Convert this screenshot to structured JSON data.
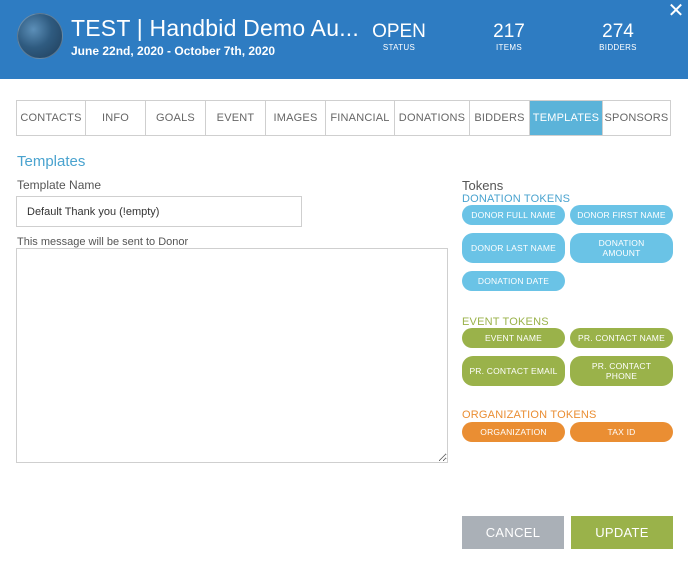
{
  "header": {
    "title": "TEST | Handbid Demo Au...",
    "dates": "June 22nd, 2020 - October 7th, 2020",
    "status": {
      "value": "OPEN",
      "label": "STATUS"
    },
    "items": {
      "value": "217",
      "label": "ITEMS"
    },
    "bidders": {
      "value": "274",
      "label": "BIDDERS"
    },
    "close_glyph": "✕"
  },
  "tabs": [
    {
      "label": "CONTACTS"
    },
    {
      "label": "INFO"
    },
    {
      "label": "GOALS"
    },
    {
      "label": "EVENT"
    },
    {
      "label": "IMAGES"
    },
    {
      "label": "FINANCIAL"
    },
    {
      "label": "DONATIONS"
    },
    {
      "label": "BIDDERS"
    },
    {
      "label": "TEMPLATES",
      "active": true
    },
    {
      "label": "SPONSORS"
    }
  ],
  "form": {
    "section_title": "Templates",
    "name_label": "Template Name",
    "name_value": "Default Thank you (!empty)",
    "message_label": "This message will be sent to Donor",
    "message_value": ""
  },
  "tokens": {
    "title": "Tokens",
    "donation": {
      "label": "DONATION TOKENS",
      "items": [
        "DONOR FULL NAME",
        "DONOR FIRST NAME",
        "DONOR LAST NAME",
        "DONATION AMOUNT",
        "DONATION DATE"
      ]
    },
    "event": {
      "label": "EVENT TOKENS",
      "items": [
        "EVENT NAME",
        "PR. CONTACT NAME",
        "PR. CONTACT EMAIL",
        "PR. CONTACT PHONE"
      ]
    },
    "organization": {
      "label": "ORGANIZATION TOKENS",
      "items": [
        "ORGANIZATION",
        "TAX ID"
      ]
    }
  },
  "buttons": {
    "cancel": "CANCEL",
    "update": "UPDATE"
  },
  "colors": {
    "header": "#2e7cc2",
    "accent": "#5bb3d9",
    "donation": "#6ac3e6",
    "event": "#9ab24a",
    "organization": "#ea8e33",
    "cancel": "#aab0b7"
  }
}
